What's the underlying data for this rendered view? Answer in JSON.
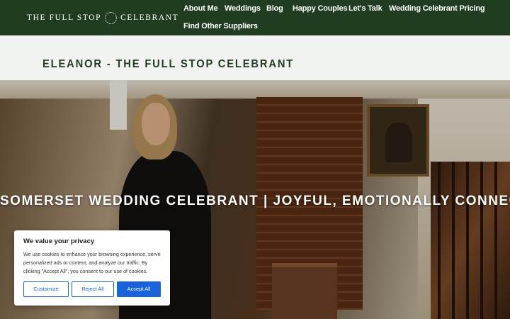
{
  "brand": {
    "logo_left": "THE FULL STOP",
    "logo_right": "CELEBRANT",
    "logo_icon": "dotted-ring-icon"
  },
  "nav": {
    "items": [
      "About Me",
      "Weddings",
      "Blog",
      "Happy Couples",
      "Let's Talk",
      "Wedding Celebrant Pricing",
      "Find Other Suppliers"
    ]
  },
  "page": {
    "title": "ELEANOR - THE FULL STOP CELEBRANT"
  },
  "hero": {
    "headline": "SOMERSET WEDDING CELEBRANT | JOYFUL, EMOTIONALLY CONNECTED CEREMONIES"
  },
  "cookie": {
    "title": "We value your privacy",
    "text": "We use cookies to enhance your browsing experience, serve personalized ads or content, and analyze our traffic. By clicking \"Accept All\", you consent to our use of cookies.",
    "customize_label": "Customize",
    "reject_label": "Reject All",
    "accept_label": "Accept All"
  },
  "colors": {
    "brand_green": "#213d21",
    "background": "#f1f3f1",
    "cookie_accent": "#1863dc"
  }
}
